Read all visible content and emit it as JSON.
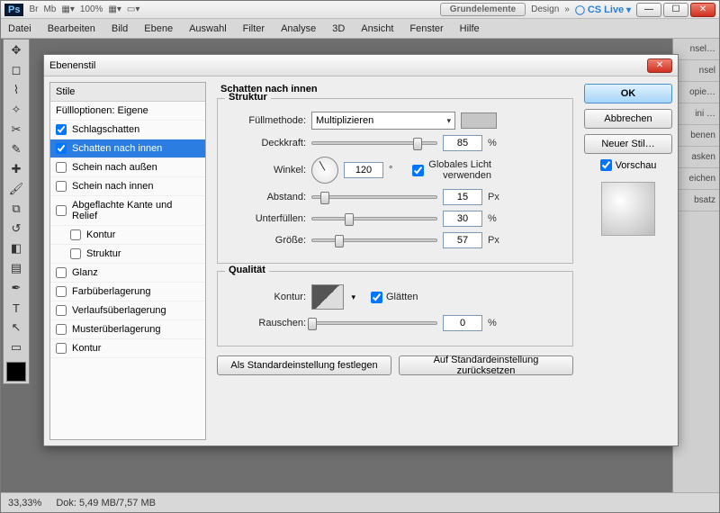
{
  "app": {
    "zoom_dropdown": "100%",
    "workspace_tab1": "Grundelemente",
    "workspace_tab2": "Design",
    "cslive": "CS Live"
  },
  "menu": [
    "Datei",
    "Bearbeiten",
    "Bild",
    "Ebene",
    "Auswahl",
    "Filter",
    "Analyse",
    "3D",
    "Ansicht",
    "Fenster",
    "Hilfe"
  ],
  "status": {
    "zoom": "33,33%",
    "doc": "Dok: 5,49 MB/7,57 MB"
  },
  "rpanel": [
    "nsel…",
    "nsel",
    "opie…",
    "ini …",
    "benen",
    "asken",
    "eichen",
    "bsatz"
  ],
  "dialog": {
    "title": "Ebenenstil",
    "styles_header": "Stile",
    "blend_options": "Füllloptionen: Eigene",
    "styles": [
      {
        "label": "Schlagschatten",
        "checked": true,
        "selected": false
      },
      {
        "label": "Schatten nach innen",
        "checked": true,
        "selected": true
      },
      {
        "label": "Schein nach außen",
        "checked": false,
        "selected": false
      },
      {
        "label": "Schein nach innen",
        "checked": false,
        "selected": false
      },
      {
        "label": "Abgeflachte Kante und Relief",
        "checked": false,
        "selected": false
      },
      {
        "label": "Kontur",
        "checked": false,
        "selected": false,
        "indent": true
      },
      {
        "label": "Struktur",
        "checked": false,
        "selected": false,
        "indent": true
      },
      {
        "label": "Glanz",
        "checked": false,
        "selected": false
      },
      {
        "label": "Farbüberlagerung",
        "checked": false,
        "selected": false
      },
      {
        "label": "Verlaufsüberlagerung",
        "checked": false,
        "selected": false
      },
      {
        "label": "Musterüberlagerung",
        "checked": false,
        "selected": false
      },
      {
        "label": "Kontur",
        "checked": false,
        "selected": false
      }
    ],
    "panel_title": "Schatten nach innen",
    "struct_group": "Struktur",
    "labels": {
      "blendmode": "Füllmethode:",
      "opacity": "Deckkraft:",
      "angle": "Winkel:",
      "global": "Globales Licht verwenden",
      "distance": "Abstand:",
      "choke": "Unterfüllen:",
      "size": "Größe:"
    },
    "values": {
      "blendmode": "Multiplizieren",
      "opacity": "85",
      "angle": "120",
      "global_checked": true,
      "distance": "15",
      "choke": "30",
      "size": "57"
    },
    "units": {
      "pct": "%",
      "px": "Px",
      "deg": "°"
    },
    "quality_group": "Qualität",
    "quality": {
      "contour": "Kontur:",
      "antialias": "Glätten",
      "antialias_checked": true,
      "noise": "Rauschen:",
      "noise_value": "0"
    },
    "buttons": {
      "default": "Als Standardeinstellung festlegen",
      "reset": "Auf Standardeinstellung zurücksetzen"
    },
    "side": {
      "ok": "OK",
      "cancel": "Abbrechen",
      "newstyle": "Neuer Stil…",
      "preview": "Vorschau"
    }
  }
}
